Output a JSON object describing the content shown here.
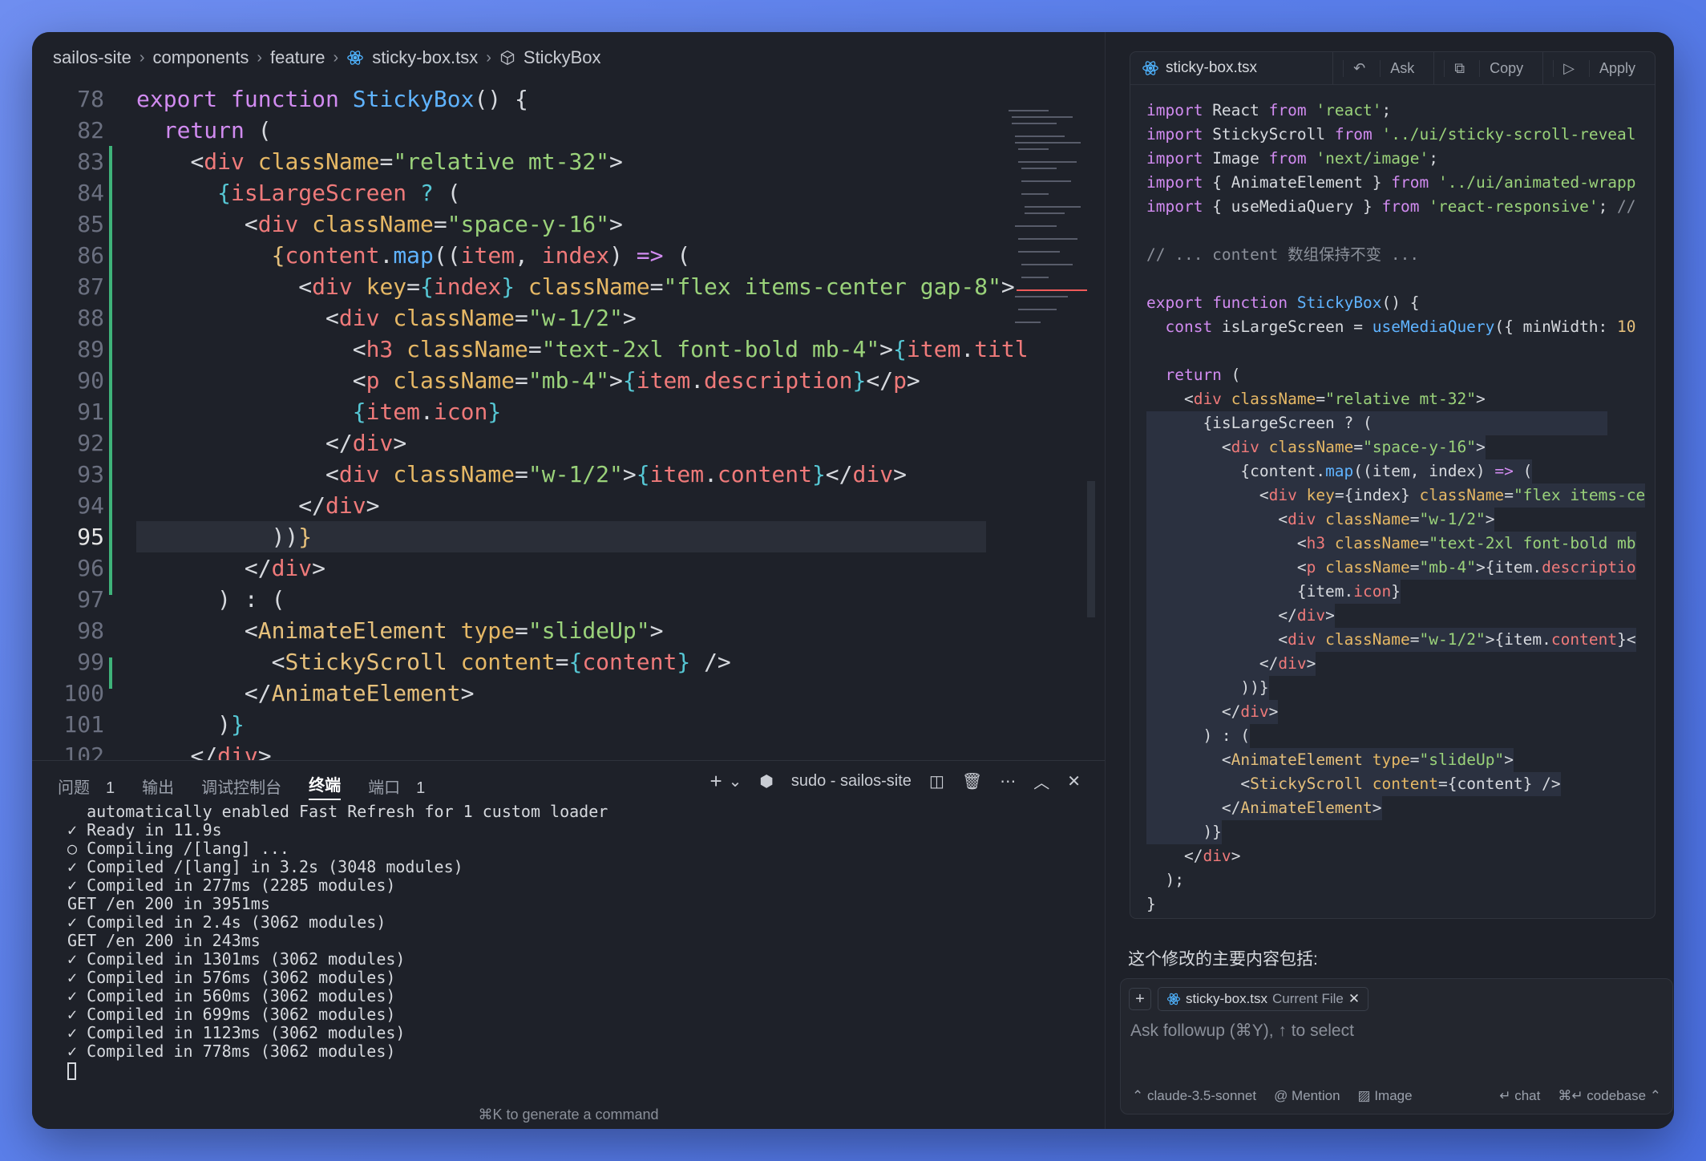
{
  "breadcrumb": [
    "sailos-site",
    "components",
    "feature",
    "sticky-box.tsx",
    "StickyBox"
  ],
  "editor": {
    "current_line": "95",
    "lines": [
      {
        "n": "78"
      },
      {
        "n": "82"
      },
      {
        "n": "83"
      },
      {
        "n": "84"
      },
      {
        "n": "85"
      },
      {
        "n": "86"
      },
      {
        "n": "87"
      },
      {
        "n": "88"
      },
      {
        "n": "89"
      },
      {
        "n": "90"
      },
      {
        "n": "91"
      },
      {
        "n": "92"
      },
      {
        "n": "93"
      },
      {
        "n": "94"
      },
      {
        "n": "95"
      },
      {
        "n": "96"
      },
      {
        "n": "97"
      },
      {
        "n": "98"
      },
      {
        "n": "99"
      },
      {
        "n": "100"
      },
      {
        "n": "101"
      },
      {
        "n": "102"
      }
    ]
  },
  "panel": {
    "tabs": [
      {
        "label": "问题",
        "count": "1"
      },
      {
        "label": "输出",
        "count": ""
      },
      {
        "label": "调试控制台",
        "count": ""
      },
      {
        "label": "终端",
        "count": "",
        "active": true
      },
      {
        "label": "端口",
        "count": "1"
      }
    ],
    "terminal_name": "sudo - sailos-site",
    "terminal_lines": [
      "  automatically enabled Fast Refresh for 1 custom loader",
      "✓ Ready in 11.9s",
      "○ Compiling /[lang] ...",
      "✓ Compiled /[lang] in 3.2s (3048 modules)",
      "✓ Compiled in 277ms (2285 modules)",
      "GET /en 200 in 3951ms",
      "✓ Compiled in 2.4s (3062 modules)",
      "GET /en 200 in 243ms",
      "✓ Compiled in 1301ms (3062 modules)",
      "✓ Compiled in 576ms (3062 modules)",
      "✓ Compiled in 560ms (3062 modules)",
      "✓ Compiled in 699ms (3062 modules)",
      "✓ Compiled in 1123ms (3062 modules)",
      "✓ Compiled in 778ms (3062 modules)"
    ],
    "hint": "⌘K to generate a command"
  },
  "side": {
    "file": "sticky-box.tsx",
    "actions": [
      "Ask",
      "Copy",
      "Apply"
    ],
    "summary": "这个修改的主要内容包括:",
    "chip_file": "sticky-box.tsx",
    "chip_sub": "Current File",
    "followup_placeholder": "Ask followup (⌘Y), ↑ to select",
    "model": "claude-3.5-sonnet",
    "mention": "Mention",
    "image": "Image",
    "chat": "chat",
    "codebase": "codebase"
  },
  "colors": {
    "accent": "#5b7fea",
    "git_added": "#3fb37a",
    "background": "#1e2129"
  }
}
